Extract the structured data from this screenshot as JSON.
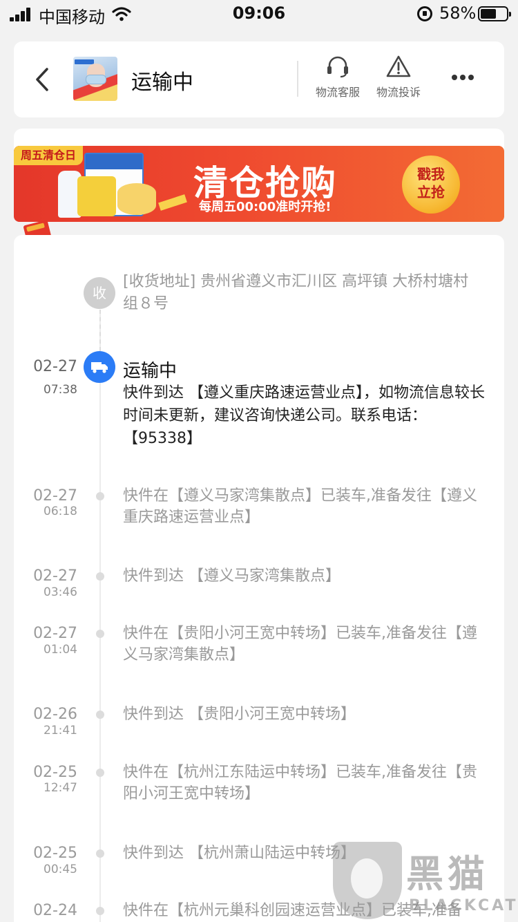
{
  "status_bar": {
    "carrier": "中国移动",
    "time": "09:06",
    "battery": "58%"
  },
  "header": {
    "title": "运输中",
    "service_label": "物流客服",
    "complaint_label": "物流投诉"
  },
  "banner": {
    "badge": "周五清仓日",
    "title": "清仓抢购",
    "subtitle": "每周五00:00准时开抢!",
    "button_line1": "戳我",
    "button_line2": "立抢"
  },
  "timeline": {
    "address_icon": "收",
    "address": "[收货地址] 贵州省遵义市汇川区  高坪镇   大桥村塘村组８号",
    "current": {
      "date": "02-27",
      "time": "07:38",
      "status": "运输中",
      "text": "快件到达 【遵义重庆路速运营业点】，如物流信息较长时间未更新，建议咨询快递公司。联系电话：【95338】"
    },
    "events": [
      {
        "date": "02-27",
        "time": "06:18",
        "text": "快件在【遵义马家湾集散点】已装车,准备发往【遵义重庆路速运营业点】"
      },
      {
        "date": "02-27",
        "time": "03:46",
        "text": "快件到达 【遵义马家湾集散点】"
      },
      {
        "date": "02-27",
        "time": "01:04",
        "text": "快件在【贵阳小河王宽中转场】已装车,准备发往【遵义马家湾集散点】"
      },
      {
        "date": "02-26",
        "time": "21:41",
        "text": "快件到达 【贵阳小河王宽中转场】"
      },
      {
        "date": "02-25",
        "time": "12:47",
        "text": "快件在【杭州江东陆运中转场】已装车,准备发往【贵阳小河王宽中转场】"
      },
      {
        "date": "02-25",
        "time": "00:45",
        "text": "快件到达 【杭州萧山陆运中转场】"
      },
      {
        "date": "02-24",
        "time": "",
        "text": "快件在【杭州元巢科创园速运营业点】已装车,准备"
      }
    ]
  },
  "watermark": {
    "cn": "黑猫",
    "en": "BLACKCAT"
  }
}
